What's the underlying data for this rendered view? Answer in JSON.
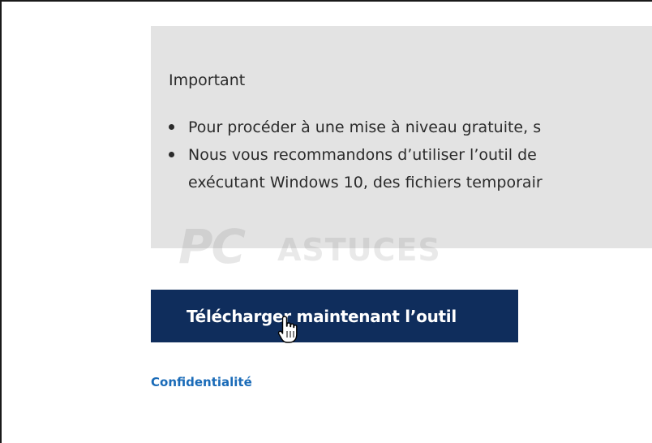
{
  "notice": {
    "title": "Important",
    "items": [
      "Pour procéder à une mise à niveau gratuite, s",
      "Nous vous recommandons d’utiliser l’outil de",
      "exécutant Windows 10, des fichiers temporair"
    ]
  },
  "watermark": {
    "logo_text_1": "PC",
    "logo_text_2": "ASTUCES"
  },
  "download_button": {
    "label": "Télécharger maintenant l’outil"
  },
  "privacy_link": {
    "label": "Confidentialité"
  },
  "colors": {
    "button_bg": "#0f2d5c",
    "notice_bg": "#e3e3e3",
    "link": "#1a6bb8"
  },
  "icons": {
    "cursor": "hand-pointer-icon"
  }
}
